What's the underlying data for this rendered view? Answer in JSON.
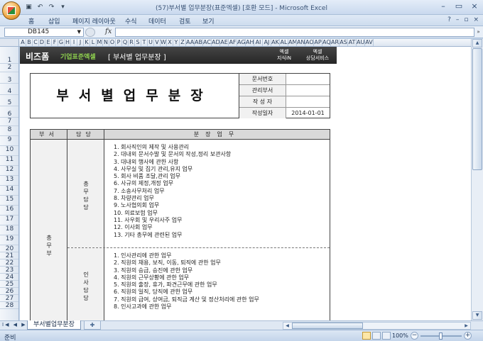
{
  "window": {
    "title": "(57)부서별 업무분장(표준엑셀) [호환 모드] - Microsoft Excel"
  },
  "ribbon": {
    "tabs": [
      "홈",
      "삽입",
      "페이지 레이아웃",
      "수식",
      "데이터",
      "검토",
      "보기"
    ]
  },
  "formula_bar": {
    "name_box": "DB145",
    "fx": "fx",
    "formula": ""
  },
  "columns": [
    "A",
    "B",
    "C",
    "D",
    "E",
    "F",
    "G",
    "H",
    "I",
    "J",
    "K",
    "L",
    "M",
    "N",
    "O",
    "P",
    "Q",
    "R",
    "S",
    "T",
    "U",
    "V",
    "W",
    "X",
    "Y",
    "Z",
    "AA",
    "AB",
    "AC",
    "AD",
    "AE",
    "AF",
    "AG",
    "AH",
    "AI",
    "AJ",
    "AK",
    "AL",
    "AM",
    "AN",
    "AO",
    "AP",
    "AQ",
    "AR",
    "AS",
    "AT",
    "AU",
    "AV"
  ],
  "rows": [
    "1",
    "2",
    "3",
    "4",
    "5",
    "6",
    "7",
    "8",
    "9",
    "10",
    "11",
    "12",
    "13",
    "14",
    "15",
    "16",
    "17",
    "18",
    "19",
    "20",
    "21",
    "22",
    "23",
    "24",
    "25",
    "26",
    "27",
    "28"
  ],
  "banner": {
    "logo": "비즈폼",
    "subtitle": "기업표준엑셀",
    "title": "[ 부서별 업무분장 ]",
    "btn1_line1": "엑셀",
    "btn1_line2": "지식iN",
    "btn2_line1": "엑셀",
    "btn2_line2": "상담서비스"
  },
  "document": {
    "title": "부서별업무분장",
    "fields": [
      {
        "label": "문서번호",
        "value": ""
      },
      {
        "label": "관리부서",
        "value": ""
      },
      {
        "label": "작 성 자",
        "value": ""
      },
      {
        "label": "작성일자",
        "value": "2014-01-01"
      }
    ],
    "table_headers": {
      "dept": "부서",
      "resp": "담당",
      "duty": "분장업무"
    },
    "department": {
      "name_chars": [
        "총",
        "무",
        "부"
      ]
    },
    "sections": [
      {
        "resp_chars": [
          "총",
          "무",
          "담",
          "당"
        ],
        "duties": [
          "1. 회사직인의 제작 및 사용관리",
          "2. 대내외 문서수발 및 문서의 작성,정리 보관사항",
          "3. 대내외 행사에 관한 사항",
          "4. 사무실 및 집기 관리,유지 업무",
          "5. 회사 비품 조달,관리 업무",
          "6. 사규의 제정,개정 업무",
          "7. 소송사무처리 업무",
          "8. 차량관리 업무",
          "9. 노사협의회 업무",
          "10. 의료보험 업무",
          "11. 사우회 및 우리사주 업무",
          "12. 이사회 업무",
          "13. 기타 총무에 관련된 업무"
        ]
      },
      {
        "resp_chars": [
          "인",
          "사",
          "담",
          "당"
        ],
        "duties": [
          "1. 인사관리에 관한 업무",
          "2. 직원의 채용, 보직, 이동, 퇴직에 관한 업무",
          "3. 직원의 승급, 승진에 관한 업무",
          "4. 직원의 근무상황에 관한 업무",
          "5. 직원의 출장, 휴가, 파견근무에 관한 업무",
          "6. 직원의 일직, 당직에 관한 업무",
          "7. 직원의 급여, 상여금, 퇴직금 계산 및 정산처리에 관한 업무",
          "8. 인사고과에 관한 업무"
        ]
      }
    ]
  },
  "sheet_tabs": {
    "active": "부서별업무분장"
  },
  "status": {
    "ready": "준비",
    "zoom": "100%"
  }
}
